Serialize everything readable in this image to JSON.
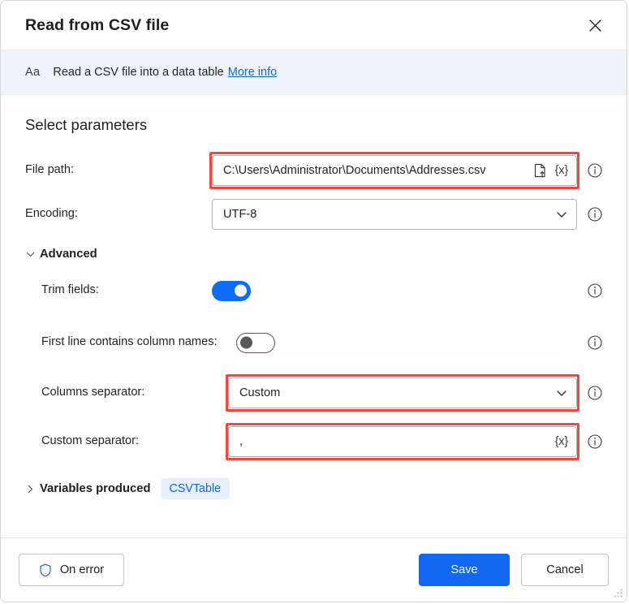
{
  "window": {
    "title": "Read from CSV file",
    "close_label": "×",
    "close_icon": "close-icon"
  },
  "banner": {
    "icon": "text-aa-icon",
    "icon_label": "Aa",
    "text": "Read a CSV file into a data table",
    "link": "More info"
  },
  "main": {
    "section_title": "Select parameters",
    "fields": [
      {
        "label": "File path:",
        "value": "C:\\Users\\Administrator\\Documents\\Addresses.csv",
        "type": "text",
        "highlighted": true,
        "file_picker_icon": "file-upload-icon",
        "variable_icon": "{x}",
        "info_icon": "info-icon"
      },
      {
        "label": "Encoding:",
        "value": "UTF-8",
        "type": "select",
        "highlighted": false,
        "chevron_icon": "chevron-down-icon",
        "info_icon": "info-icon"
      }
    ],
    "advanced": {
      "label": "Advanced",
      "expanded": true,
      "caret_icon": "chevron-down-icon",
      "options": [
        {
          "label": "Trim fields:",
          "type": "toggle",
          "value": "on",
          "info_icon": "info-icon"
        },
        {
          "label": "First line contains column names:",
          "type": "toggle",
          "value": "off",
          "info_icon": "info-icon"
        },
        {
          "label": "Columns separator:",
          "type": "select",
          "value": "Custom",
          "highlighted": true,
          "chevron_icon": "chevron-down-icon",
          "info_icon": "info-icon"
        },
        {
          "label": "Custom separator:",
          "type": "text",
          "value": ",",
          "highlighted": true,
          "variable_icon": "{x}",
          "info_icon": "info-icon"
        }
      ]
    },
    "variables_produced": {
      "label": "Variables produced",
      "expanded": false,
      "caret_icon": "chevron-right-icon",
      "pill": "CSVTable"
    }
  },
  "footer": {
    "on_error_label": "On error",
    "on_error_icon": "shield-icon",
    "save_label": "Save",
    "cancel_label": "Cancel",
    "resize_grip": "resize-grip"
  },
  "colors": {
    "accent": "#1268f0",
    "highlight": "#f4463f",
    "banner_bg": "#eff3fc",
    "link": "#1267d4",
    "pill_bg": "#e7eefc"
  }
}
